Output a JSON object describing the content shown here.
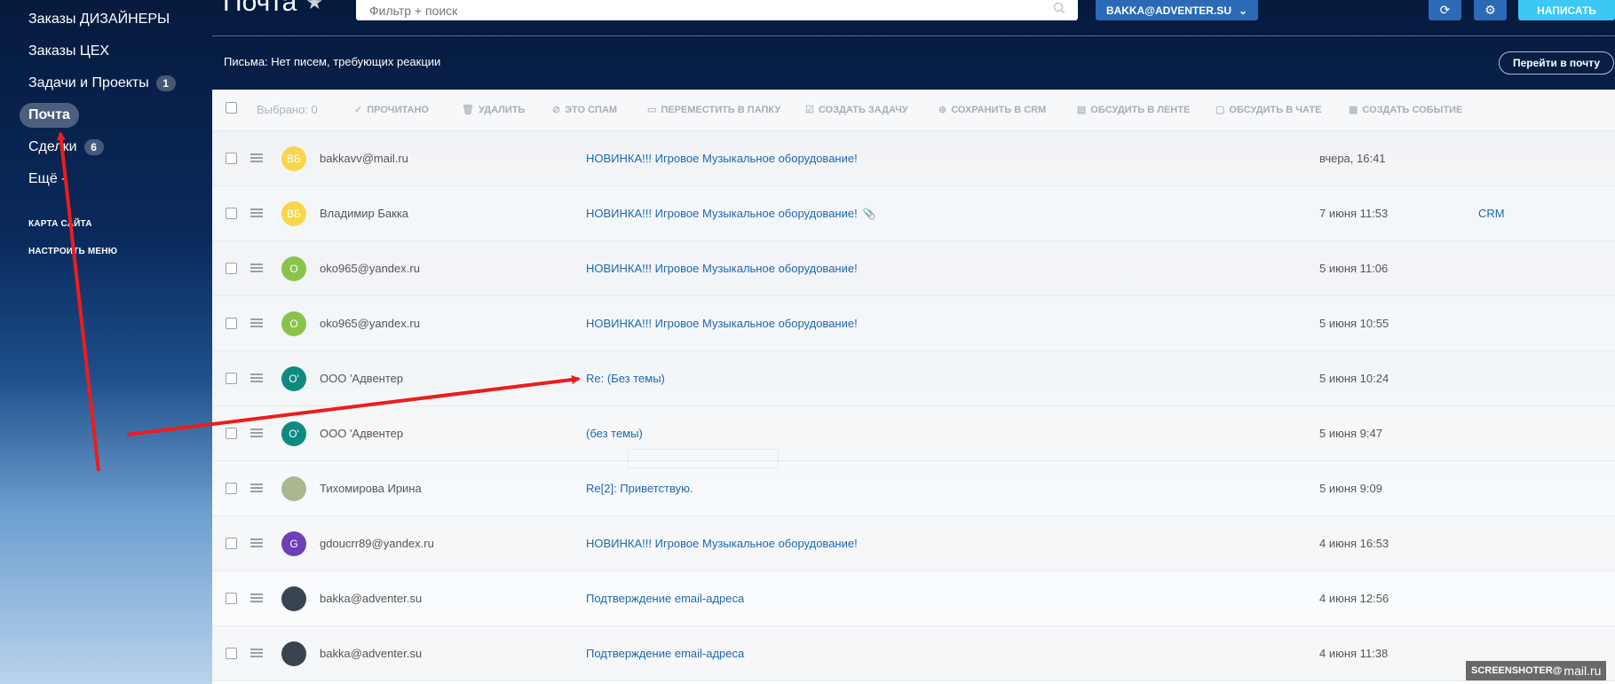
{
  "sidebar": {
    "items": [
      {
        "label": "Заказы ДИЗАЙНЕРЫ",
        "counter": ""
      },
      {
        "label": "Заказы ЦЕХ",
        "counter": ""
      },
      {
        "label": "Задачи и Проекты",
        "counter": "1"
      },
      {
        "label": "Почта",
        "counter": ""
      },
      {
        "label": "Сделки",
        "counter": "6"
      },
      {
        "label": "Ещё -",
        "counter": ""
      }
    ],
    "sitemap_label": "КАРТА САЙТА",
    "configure_label": "НАСТРОИТЬ МЕНЮ"
  },
  "header": {
    "title": "Почта",
    "search_placeholder": "Фильтр + поиск",
    "mailbox": "BAKKA@ADVENTER.SU",
    "compose_label": "НАПИСАТЬ",
    "notice": "Письма: Нет писем, требующих реакции",
    "goto_mail_label": "Перейти в почту"
  },
  "toolbar": {
    "selected": "Выбрано: 0",
    "actions": [
      {
        "label": "ПРОЧИТАНО",
        "icon": "check-icon"
      },
      {
        "label": "УДАЛИТЬ",
        "icon": "trash-icon"
      },
      {
        "label": "ЭТО СПАМ",
        "icon": "spam-icon"
      },
      {
        "label": "ПЕРЕМЕСТИТЬ В ПАПКУ",
        "icon": "folder-icon"
      },
      {
        "label": "СОЗДАТЬ ЗАДАЧУ",
        "icon": "task-icon"
      },
      {
        "label": "СОХРАНИТЬ В CRM",
        "icon": "crm-icon"
      },
      {
        "label": "ОБСУДИТЬ В ЛЕНТЕ",
        "icon": "feed-icon"
      },
      {
        "label": "ОБСУДИТЬ В ЧАТЕ",
        "icon": "chat-icon"
      },
      {
        "label": "СОЗДАТЬ СОБЫТИЕ",
        "icon": "calendar-icon"
      }
    ]
  },
  "messages": [
    {
      "initials": "ВБ",
      "avatar_color": "#f7d64a",
      "sender": "bakkavv@mail.ru",
      "subject": "НОВИНКА!!! Игровое Музыкальное оборудование!",
      "date": "вчера, 16:41",
      "crm": "",
      "clip": false
    },
    {
      "initials": "ВБ",
      "avatar_color": "#f7d64a",
      "sender": "Владимир Бакка",
      "subject": "НОВИНКА!!! Игровое Музыкальное оборудование!",
      "date": "7 июня 11:53",
      "crm": "CRM",
      "clip": true
    },
    {
      "initials": "O",
      "avatar_color": "#8bc34a",
      "sender": "oko965@yandex.ru",
      "subject": "НОВИНКА!!! Игровое Музыкальное оборудование!",
      "date": "5 июня 11:06",
      "crm": "",
      "clip": false
    },
    {
      "initials": "O",
      "avatar_color": "#8bc34a",
      "sender": "oko965@yandex.ru",
      "subject": "НОВИНКА!!! Игровое Музыкальное оборудование!",
      "date": "5 июня 10:55",
      "crm": "",
      "clip": false
    },
    {
      "initials": "О'",
      "avatar_color": "#0f8a80",
      "sender": "ООО 'Адвентер",
      "subject": "Re: (Без темы)",
      "date": "5 июня 10:24",
      "crm": "",
      "clip": false
    },
    {
      "initials": "О'",
      "avatar_color": "#0f8a80",
      "sender": "ООО 'Адвентер",
      "subject": "(без темы)",
      "date": "5 июня 9:47",
      "crm": "",
      "clip": false
    },
    {
      "initials": "",
      "avatar_color": "#a8b890",
      "sender": "Тихомирова Ирина",
      "subject": "Re[2]: Приветствую.",
      "date": "5 июня 9:09",
      "crm": "",
      "clip": false
    },
    {
      "initials": "G",
      "avatar_color": "#6d3fb8",
      "sender": "gdoucrr89@yandex.ru",
      "subject": "НОВИНКА!!! Игровое Музыкальное оборудование!",
      "date": "4 июня 16:53",
      "crm": "",
      "clip": false
    },
    {
      "initials": "",
      "avatar_color": "#3a4450",
      "sender": "bakka@adventer.su",
      "subject": "Подтверждение email-адреса",
      "date": "4 июня 12:56",
      "crm": "",
      "clip": false
    },
    {
      "initials": "",
      "avatar_color": "#3a4450",
      "sender": "bakka@adventer.su",
      "subject": "Подтверждение email-адреса",
      "date": "4 июня 11:38",
      "crm": "",
      "clip": false
    }
  ],
  "watermark": {
    "prefix": "SCREENSHOTER@",
    "brand": "mail.ru"
  },
  "colors": {
    "accent": "#2a6ab6",
    "compose": "#3bc8f5",
    "link": "#2067b0",
    "arrow": "#ee1c1c"
  }
}
